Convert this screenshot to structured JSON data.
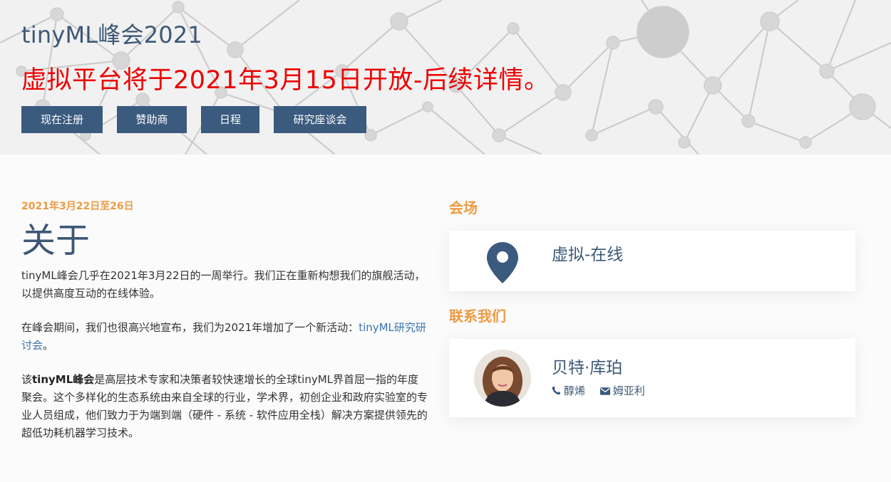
{
  "hero": {
    "title": "tinyML峰会2021",
    "announcement": "虚拟平台将于2021年3月15日开放-后续详情。",
    "buttons": [
      {
        "label": "现在注册"
      },
      {
        "label": "赞助商"
      },
      {
        "label": "日程"
      },
      {
        "label": "研究座谈会"
      }
    ]
  },
  "about": {
    "date": "2021年3月22日至26日",
    "heading": "关于",
    "p1": "tinyML峰会几乎在2021年3月22日的一周举行。我们正在重新构想我们的旗舰活动，以提供高度互动的在线体验。",
    "p2_text": "在峰会期间，我们也很高兴地宣布，我们为2021年增加了一个新活动：",
    "p2_link": "tinyML研究研讨会",
    "p2_end": "。",
    "p3_prefix": "该",
    "p3_bold": "tinyML峰会",
    "p3_text": "是高层技术专家和决策者较快速增长的全球tinyML界首屈一指的年度聚会。这个多样化的生态系统由来自全球的行业，学术界，初创企业和政府实验室的专业人员组成，他们致力于为端到端（硬件 - 系统 - 软件应用全栈）解决方案提供领先的超低功耗机器学习技术。"
  },
  "venue": {
    "label": "会场",
    "text": "虚拟-在线",
    "icon": "map-marker-icon"
  },
  "contact": {
    "label": "联系我们",
    "name": "贝特·库珀",
    "phone_label": "醇烯",
    "email_label": "姆亚利",
    "phone_icon": "phone-icon",
    "email_icon": "envelope-icon"
  },
  "colors": {
    "navy": "#3a5a7e",
    "heading": "#3d5876",
    "accent_orange": "#ee9a40",
    "announcement_red": "#ee0000",
    "link_blue": "#3a73b0"
  }
}
